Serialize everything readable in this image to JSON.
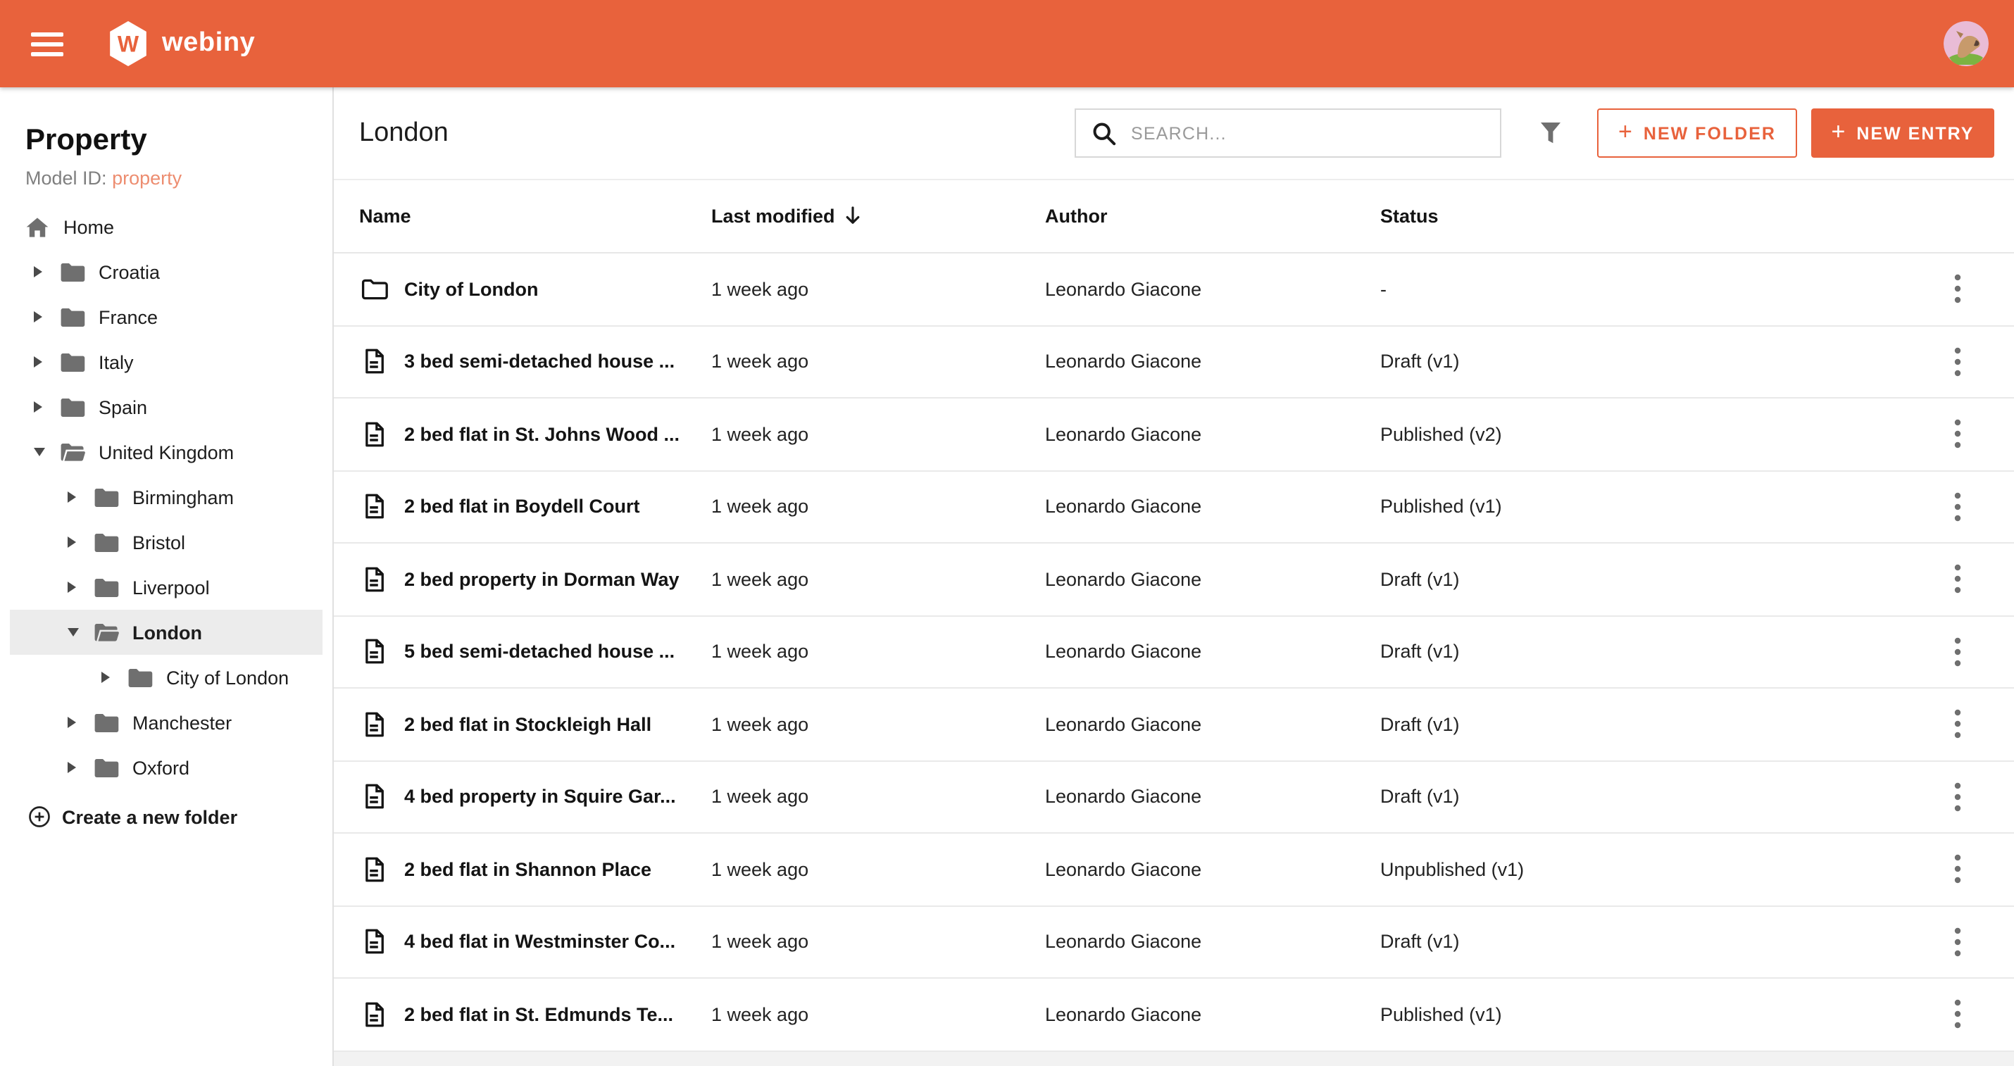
{
  "colors": {
    "accent": "#E8623C",
    "model_id_link": "#ED8D70",
    "selected_row_bg": "#ECECEC"
  },
  "topbar": {
    "brand": "webiny",
    "brand_initial": "W"
  },
  "sidebar": {
    "title": "Property",
    "model_id_label": "Model ID:",
    "model_id_value": "property",
    "home_label": "Home",
    "create_folder_label": "Create a new folder",
    "tree": [
      {
        "label": "Croatia",
        "level": 1,
        "state": "collapsed",
        "selected": false
      },
      {
        "label": "France",
        "level": 1,
        "state": "collapsed",
        "selected": false
      },
      {
        "label": "Italy",
        "level": 1,
        "state": "collapsed",
        "selected": false
      },
      {
        "label": "Spain",
        "level": 1,
        "state": "collapsed",
        "selected": false
      },
      {
        "label": "United Kingdom",
        "level": 1,
        "state": "expanded",
        "selected": false
      },
      {
        "label": "Birmingham",
        "level": 2,
        "state": "collapsed",
        "selected": false
      },
      {
        "label": "Bristol",
        "level": 2,
        "state": "collapsed",
        "selected": false
      },
      {
        "label": "Liverpool",
        "level": 2,
        "state": "collapsed",
        "selected": false
      },
      {
        "label": "London",
        "level": 2,
        "state": "expanded",
        "selected": true
      },
      {
        "label": "City of London",
        "level": 3,
        "state": "collapsed",
        "selected": false
      },
      {
        "label": "Manchester",
        "level": 2,
        "state": "collapsed",
        "selected": false
      },
      {
        "label": "Oxford",
        "level": 2,
        "state": "collapsed",
        "selected": false
      }
    ]
  },
  "toolbar": {
    "page_title": "London",
    "search_placeholder": "SEARCH...",
    "new_folder_label": "NEW FOLDER",
    "new_entry_label": "NEW ENTRY"
  },
  "table": {
    "columns": {
      "name": "Name",
      "modified": "Last modified",
      "author": "Author",
      "status": "Status"
    },
    "sort": {
      "column": "Last modified",
      "direction": "desc"
    },
    "rows": [
      {
        "type": "folder",
        "name": "City of London",
        "modified": "1 week ago",
        "author": "Leonardo Giacone",
        "status": "-"
      },
      {
        "type": "entry",
        "name": "3 bed semi-detached house ...",
        "modified": "1 week ago",
        "author": "Leonardo Giacone",
        "status": "Draft (v1)"
      },
      {
        "type": "entry",
        "name": "2 bed flat in St. Johns Wood ...",
        "modified": "1 week ago",
        "author": "Leonardo Giacone",
        "status": "Published (v2)"
      },
      {
        "type": "entry",
        "name": "2 bed flat in Boydell Court",
        "modified": "1 week ago",
        "author": "Leonardo Giacone",
        "status": "Published (v1)"
      },
      {
        "type": "entry",
        "name": "2 bed property in Dorman Way",
        "modified": "1 week ago",
        "author": "Leonardo Giacone",
        "status": "Draft (v1)"
      },
      {
        "type": "entry",
        "name": "5 bed semi-detached house ...",
        "modified": "1 week ago",
        "author": "Leonardo Giacone",
        "status": "Draft (v1)"
      },
      {
        "type": "entry",
        "name": "2 bed flat in Stockleigh Hall",
        "modified": "1 week ago",
        "author": "Leonardo Giacone",
        "status": "Draft (v1)"
      },
      {
        "type": "entry",
        "name": "4 bed property in Squire Gar...",
        "modified": "1 week ago",
        "author": "Leonardo Giacone",
        "status": "Draft (v1)"
      },
      {
        "type": "entry",
        "name": "2 bed flat in Shannon Place",
        "modified": "1 week ago",
        "author": "Leonardo Giacone",
        "status": "Unpublished (v1)"
      },
      {
        "type": "entry",
        "name": "4 bed flat in Westminster Co...",
        "modified": "1 week ago",
        "author": "Leonardo Giacone",
        "status": "Draft (v1)"
      },
      {
        "type": "entry",
        "name": "2 bed flat in St. Edmunds Te...",
        "modified": "1 week ago",
        "author": "Leonardo Giacone",
        "status": "Published (v1)"
      }
    ]
  }
}
